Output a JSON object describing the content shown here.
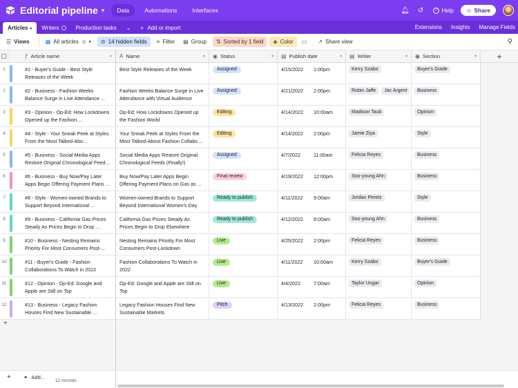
{
  "header": {
    "title": "Editorial pipeline",
    "nav": [
      "Data",
      "Automations",
      "Interfaces"
    ],
    "help_label": "Help",
    "share_label": "Share"
  },
  "tabs": {
    "items": [
      "Articles",
      "Writers",
      "Production tasks"
    ],
    "add_label": "Add or import",
    "right": [
      "Extensions",
      "Insights",
      "Manage Fields"
    ]
  },
  "toolbar": {
    "views_label": "Views",
    "view_name": "All articles",
    "hidden_fields": "14 hidden fields",
    "filter": "Filter",
    "group": "Group",
    "sorted": "Sorted by 1 field",
    "color": "Color",
    "share_view": "Share view"
  },
  "columns": [
    "Article name",
    "Name",
    "Status",
    "Publish date",
    "Writer",
    "Section"
  ],
  "colors": {
    "accent": "#7c3cf0",
    "status": {
      "Assigned": "#d1e2ff",
      "Editing": "#ffe19c",
      "Final review": "#ffcce0",
      "Ready to publish": "#9fe8d8",
      "Live": "#b3ea8a",
      "Pitch": "#dfcdff"
    }
  },
  "rows": [
    {
      "num": "1",
      "bar": "#8ab4f8",
      "article": "#1 - Buyer's Guide - Best Style Releases of the Week",
      "name": "Best Style Releases of the Week",
      "status": "Assigned",
      "date": "4/15/2022",
      "time": "1:00pm",
      "writers": [
        "Kerry Szabo"
      ],
      "section": "Buyer's Guide"
    },
    {
      "num": "2",
      "bar": "#8ab4f8",
      "article": "#2 - Business - Fashion Weeks Balance Surge in Live Attendance ...",
      "name": "Fashion Weeks Balance Surge in Live Attendance with Virtual Audience",
      "status": "Assigned",
      "date": "4/21/2022",
      "time": "2:00pm",
      "writers": [
        "Robin Jaffe",
        "Jac Argent"
      ],
      "section": "Business"
    },
    {
      "num": "3",
      "bar": "#fcd35b",
      "article": "#3 - Opinion - Op-Ed: How Lockdowns Opened up the Fashion ...",
      "name": "Op-Ed: How Lockdowns Opened up the Fashion World",
      "status": "Editing",
      "date": "4/14/2022",
      "time": "10:00am",
      "writers": [
        "Madison Taub"
      ],
      "section": "Opinion"
    },
    {
      "num": "4",
      "bar": "#fcd35b",
      "article": "#4 - Style - Your Sneak Peek at Styles From the Most Talked-Abo...",
      "name": "Your Sneak Peek at Styles From the Most Talked-About Fashion Collabs ...",
      "status": "Editing",
      "date": "4/14/2022",
      "time": "2:00pm",
      "writers": [
        "Jamie Ziya"
      ],
      "section": "Style"
    },
    {
      "num": "5",
      "bar": "#8ab4f8",
      "article": "#5 - Business - Social Media Apps Restore Original Chronological Feed...",
      "name": "Social Media Apps Restore Original Chronological Feeds (Finally!)",
      "status": "Assigned",
      "date": "4/7/2022",
      "time": "11:00am",
      "writers": [
        "Felicia Reyes"
      ],
      "section": "Business"
    },
    {
      "num": "6",
      "bar": "#f58fb6",
      "article": "#6 - Business - Buy Now/Pay Later Apps Begin Offering Payment Plans ...",
      "name": "Buy Now/Pay Later Apps Begin Offering Payment Plans on Gas as ...",
      "status": "Final review",
      "date": "4/19/2022",
      "time": "12:00pm",
      "writers": [
        "Soo-young Ahn"
      ],
      "section": "Business"
    },
    {
      "num": "7",
      "bar": "#5fd6c3",
      "article": "#8 - Style - Women-owned Brands to Support Beyond International ...",
      "name": "Women-owned Brands to Support Beyond International Women's Day",
      "status": "Ready to publish",
      "date": "4/11/2022",
      "time": "9:00am",
      "writers": [
        "Jordan Peretz"
      ],
      "section": "Style"
    },
    {
      "num": "8",
      "bar": "#5fd6c3",
      "article": "#9 - Business - California Gas Prices Steady As Prices Begin to Drop ...",
      "name": "California Gas Prices Steady As Prices Begin to Drop Elsewhere",
      "status": "Ready to publish",
      "date": "4/12/2022",
      "time": "8:00am",
      "writers": [
        "Soo-young Ahn"
      ],
      "section": "Business"
    },
    {
      "num": "9",
      "bar": "#7fd36a",
      "article": "#10 - Business - Nesting Remains Priority For Most Consumers Post-...",
      "name": "Nesting Remains Priority For Most Consumers Post-Lockdown",
      "status": "Live",
      "date": "4/25/2022",
      "time": "2:00pm",
      "writers": [
        "Felicia Reyes"
      ],
      "section": "Business"
    },
    {
      "num": "10",
      "bar": "#7fd36a",
      "article": "#11 - Buyer's Guide - Fashion Collaborations To Watch in 2022",
      "name": "Fashion Collaborations To Watch in 2022",
      "status": "Live",
      "date": "4/11/2022",
      "time": "10:00am",
      "writers": [
        "Kerry Szabo"
      ],
      "section": "Buyer's Guide"
    },
    {
      "num": "11",
      "bar": "#7fd36a",
      "article": "#12 - Opinion - Op-Ed: Google and Apple are Still on Top",
      "name": "Op-Ed: Google and Apple are Still on Top",
      "status": "Live",
      "date": "4/4/2022",
      "time": "7:00am",
      "writers": [
        "Taylor Ungar"
      ],
      "section": "Opinion"
    },
    {
      "num": "12",
      "bar": "#c8a9f5",
      "article": "#13 - Business - Legacy Fashion Houses Find New Sustainable ...",
      "name": "Legacy Fashion Houses Find New Sustainable Markets",
      "status": "Pitch",
      "date": "4/13/2022",
      "time": "2:00pm",
      "writers": [
        "Felicia Reyes"
      ],
      "section": "Business"
    }
  ],
  "footer": {
    "add_label": "Add...",
    "record_count": "12 records"
  }
}
